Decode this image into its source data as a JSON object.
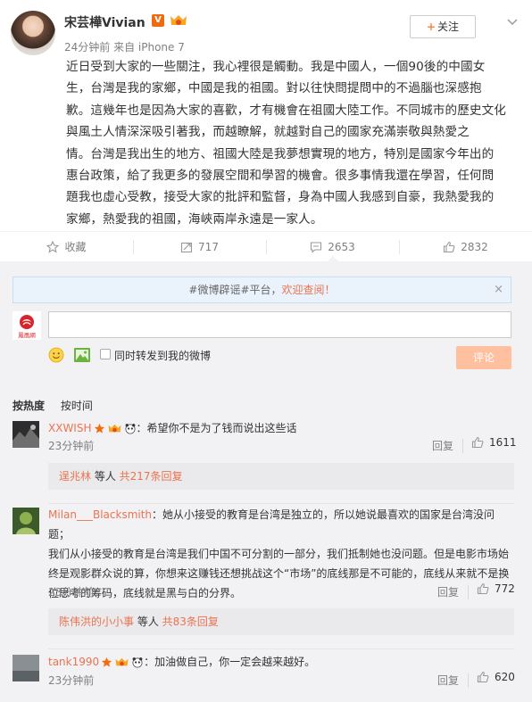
{
  "post": {
    "username": "宋芸樺Vivian",
    "vip_label": "V",
    "meta": "24分钟前 来自 iPhone 7",
    "follow_label": "关注",
    "text": "近日受到大家的一些關注，我心裡很是觸動。我是中國人，一個90後的中國女\n生，台灣是我的家鄉，中國是我的祖國。對以往快問提問中的不過腦也深感抱\n歉。這幾年也是因為大家的喜歡，才有機會在祖國大陸工作。不同城市的歷史文化\n與風土人情深深吸引著我，而越瞭解，就越對自己的國家充滿崇敬與熱愛之\n情。台灣是我出生的地方、祖國大陸是我夢想實現的地方，特別是國家今年出的\n惠台政策，給了我更多的發展空間和學習的機會。很多事情我還在學習，任何問\n題我也虛心受教，接受大家的批評和監督，身為中國人我感到自豪，我熱愛我的\n家鄉，熱愛我的祖國，海峽兩岸永遠是一家人。"
  },
  "actions": {
    "favorite_label": "收藏",
    "repost_count": "717",
    "comment_count": "2653",
    "like_count": "2832"
  },
  "notice": {
    "prefix": "#微博辟谣#平台，",
    "highlight": "欢迎查阅！",
    "close": "×"
  },
  "composer": {
    "logo_text": "鳳凰網",
    "repost_label": "同时转发到我的微博",
    "submit_label": "评论"
  },
  "sort": {
    "hot": "按热度",
    "time": "按时间"
  },
  "comments": [
    {
      "user": "XXWISH",
      "text": "：希望你不是为了钱而说出这些话",
      "time": "23分钟前",
      "reply": "回复",
      "likes": "1611",
      "sub_user": "逞兆林",
      "sub_mid": " 等人 ",
      "sub_count": "共217条回复"
    },
    {
      "user": "Milan___Blacksmith",
      "text": "：她从小接受的教育是台湾是独立的，所以她说最喜欢的国家是台湾没问题；\n我们从小接受的教育是台湾是我们中国不可分割的一部分，我们抵制她也没问题。但是电影市场始\n终是观影群众说的算，你想来这赚钱还想挑战这个“市场”的底线那是不可能的，底线从来就不是换\n位思考的筹码，底线就是黑与白的分界。",
      "time": "23分钟前",
      "reply": "回复",
      "likes": "772",
      "sub_user": "陈伟洪的小小事",
      "sub_mid": " 等人 ",
      "sub_count": "共83条回复"
    },
    {
      "user": "tank1990",
      "text": "：加油做自己，你一定会越来越好。",
      "time": "23分钟前",
      "reply": "回复",
      "likes": "620"
    }
  ],
  "colors": {
    "accent": "#eb7350",
    "link": "#eb7350",
    "background": "#f2f2f5",
    "submit": "#ffc09f"
  }
}
